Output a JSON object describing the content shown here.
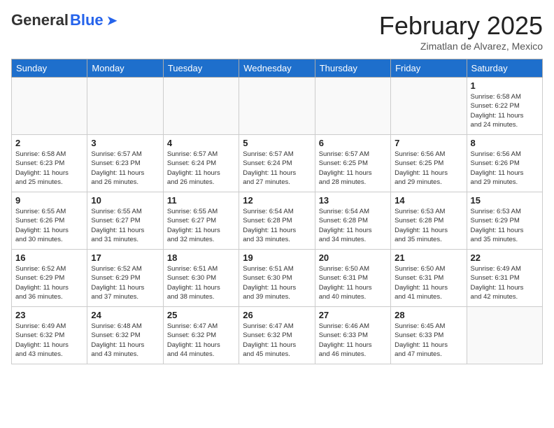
{
  "header": {
    "logo_general": "General",
    "logo_blue": "Blue",
    "month_title": "February 2025",
    "subtitle": "Zimatlan de Alvarez, Mexico"
  },
  "days_of_week": [
    "Sunday",
    "Monday",
    "Tuesday",
    "Wednesday",
    "Thursday",
    "Friday",
    "Saturday"
  ],
  "weeks": [
    [
      {
        "day": "",
        "info": ""
      },
      {
        "day": "",
        "info": ""
      },
      {
        "day": "",
        "info": ""
      },
      {
        "day": "",
        "info": ""
      },
      {
        "day": "",
        "info": ""
      },
      {
        "day": "",
        "info": ""
      },
      {
        "day": "1",
        "info": "Sunrise: 6:58 AM\nSunset: 6:22 PM\nDaylight: 11 hours\nand 24 minutes."
      }
    ],
    [
      {
        "day": "2",
        "info": "Sunrise: 6:58 AM\nSunset: 6:23 PM\nDaylight: 11 hours\nand 25 minutes."
      },
      {
        "day": "3",
        "info": "Sunrise: 6:57 AM\nSunset: 6:23 PM\nDaylight: 11 hours\nand 26 minutes."
      },
      {
        "day": "4",
        "info": "Sunrise: 6:57 AM\nSunset: 6:24 PM\nDaylight: 11 hours\nand 26 minutes."
      },
      {
        "day": "5",
        "info": "Sunrise: 6:57 AM\nSunset: 6:24 PM\nDaylight: 11 hours\nand 27 minutes."
      },
      {
        "day": "6",
        "info": "Sunrise: 6:57 AM\nSunset: 6:25 PM\nDaylight: 11 hours\nand 28 minutes."
      },
      {
        "day": "7",
        "info": "Sunrise: 6:56 AM\nSunset: 6:25 PM\nDaylight: 11 hours\nand 29 minutes."
      },
      {
        "day": "8",
        "info": "Sunrise: 6:56 AM\nSunset: 6:26 PM\nDaylight: 11 hours\nand 29 minutes."
      }
    ],
    [
      {
        "day": "9",
        "info": "Sunrise: 6:55 AM\nSunset: 6:26 PM\nDaylight: 11 hours\nand 30 minutes."
      },
      {
        "day": "10",
        "info": "Sunrise: 6:55 AM\nSunset: 6:27 PM\nDaylight: 11 hours\nand 31 minutes."
      },
      {
        "day": "11",
        "info": "Sunrise: 6:55 AM\nSunset: 6:27 PM\nDaylight: 11 hours\nand 32 minutes."
      },
      {
        "day": "12",
        "info": "Sunrise: 6:54 AM\nSunset: 6:28 PM\nDaylight: 11 hours\nand 33 minutes."
      },
      {
        "day": "13",
        "info": "Sunrise: 6:54 AM\nSunset: 6:28 PM\nDaylight: 11 hours\nand 34 minutes."
      },
      {
        "day": "14",
        "info": "Sunrise: 6:53 AM\nSunset: 6:28 PM\nDaylight: 11 hours\nand 35 minutes."
      },
      {
        "day": "15",
        "info": "Sunrise: 6:53 AM\nSunset: 6:29 PM\nDaylight: 11 hours\nand 35 minutes."
      }
    ],
    [
      {
        "day": "16",
        "info": "Sunrise: 6:52 AM\nSunset: 6:29 PM\nDaylight: 11 hours\nand 36 minutes."
      },
      {
        "day": "17",
        "info": "Sunrise: 6:52 AM\nSunset: 6:29 PM\nDaylight: 11 hours\nand 37 minutes."
      },
      {
        "day": "18",
        "info": "Sunrise: 6:51 AM\nSunset: 6:30 PM\nDaylight: 11 hours\nand 38 minutes."
      },
      {
        "day": "19",
        "info": "Sunrise: 6:51 AM\nSunset: 6:30 PM\nDaylight: 11 hours\nand 39 minutes."
      },
      {
        "day": "20",
        "info": "Sunrise: 6:50 AM\nSunset: 6:31 PM\nDaylight: 11 hours\nand 40 minutes."
      },
      {
        "day": "21",
        "info": "Sunrise: 6:50 AM\nSunset: 6:31 PM\nDaylight: 11 hours\nand 41 minutes."
      },
      {
        "day": "22",
        "info": "Sunrise: 6:49 AM\nSunset: 6:31 PM\nDaylight: 11 hours\nand 42 minutes."
      }
    ],
    [
      {
        "day": "23",
        "info": "Sunrise: 6:49 AM\nSunset: 6:32 PM\nDaylight: 11 hours\nand 43 minutes."
      },
      {
        "day": "24",
        "info": "Sunrise: 6:48 AM\nSunset: 6:32 PM\nDaylight: 11 hours\nand 43 minutes."
      },
      {
        "day": "25",
        "info": "Sunrise: 6:47 AM\nSunset: 6:32 PM\nDaylight: 11 hours\nand 44 minutes."
      },
      {
        "day": "26",
        "info": "Sunrise: 6:47 AM\nSunset: 6:32 PM\nDaylight: 11 hours\nand 45 minutes."
      },
      {
        "day": "27",
        "info": "Sunrise: 6:46 AM\nSunset: 6:33 PM\nDaylight: 11 hours\nand 46 minutes."
      },
      {
        "day": "28",
        "info": "Sunrise: 6:45 AM\nSunset: 6:33 PM\nDaylight: 11 hours\nand 47 minutes."
      },
      {
        "day": "",
        "info": ""
      }
    ]
  ]
}
